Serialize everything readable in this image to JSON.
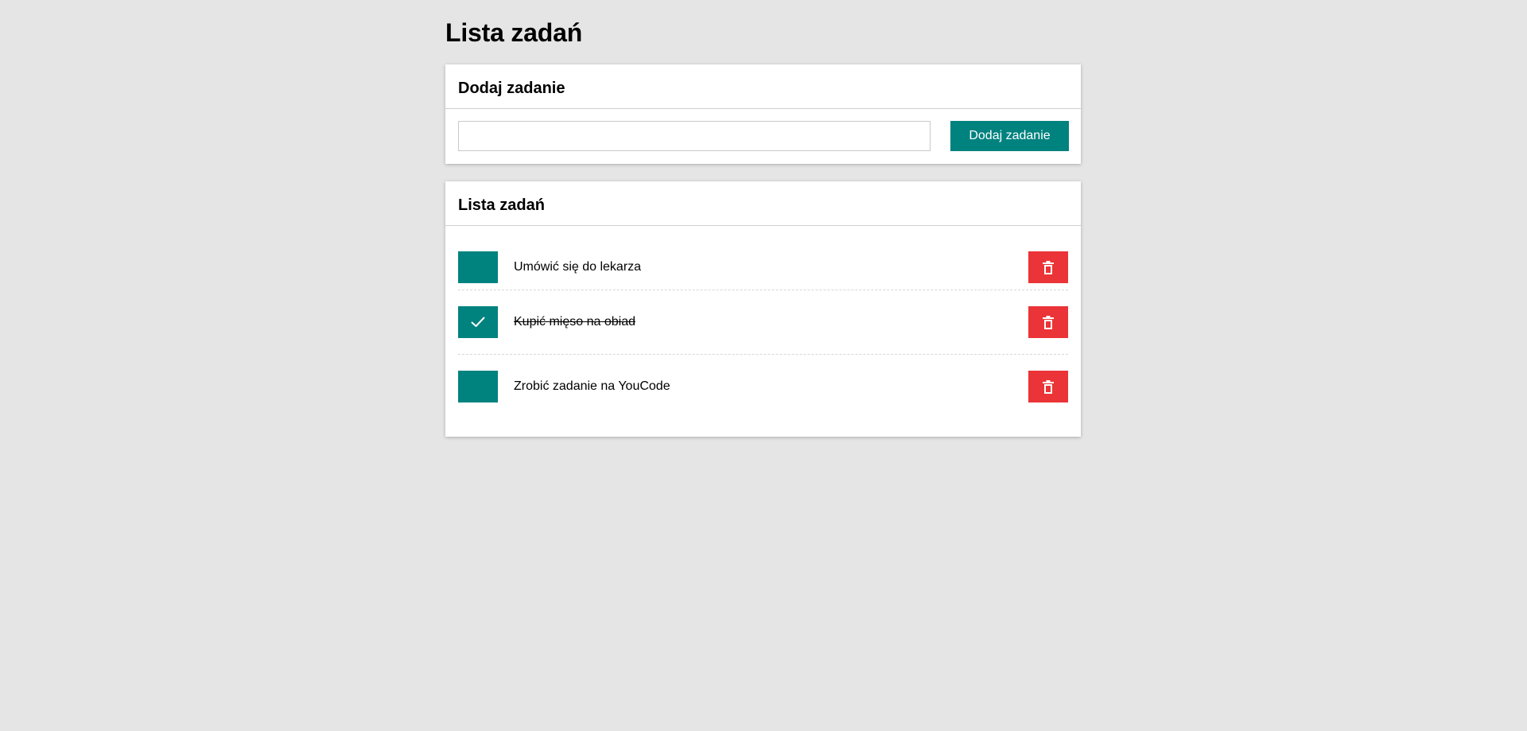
{
  "page": {
    "title": "Lista zadań"
  },
  "add_card": {
    "title": "Dodaj zadanie",
    "input_value": "",
    "input_placeholder": "",
    "button_label": "Dodaj zadanie"
  },
  "list_card": {
    "title": "Lista zadań",
    "tasks": [
      {
        "text": "Umówić się do lekarza",
        "done": false
      },
      {
        "text": "Kupić mięso na obiad",
        "done": true
      },
      {
        "text": "Zrobić zadanie na YouCode",
        "done": false
      }
    ]
  },
  "icons": {
    "checkbox_checked": "check-icon",
    "delete": "trash-icon"
  },
  "colors": {
    "background": "#e5e5e5",
    "accent": "#00827f",
    "danger": "#ea3437",
    "card": "#ffffff"
  }
}
